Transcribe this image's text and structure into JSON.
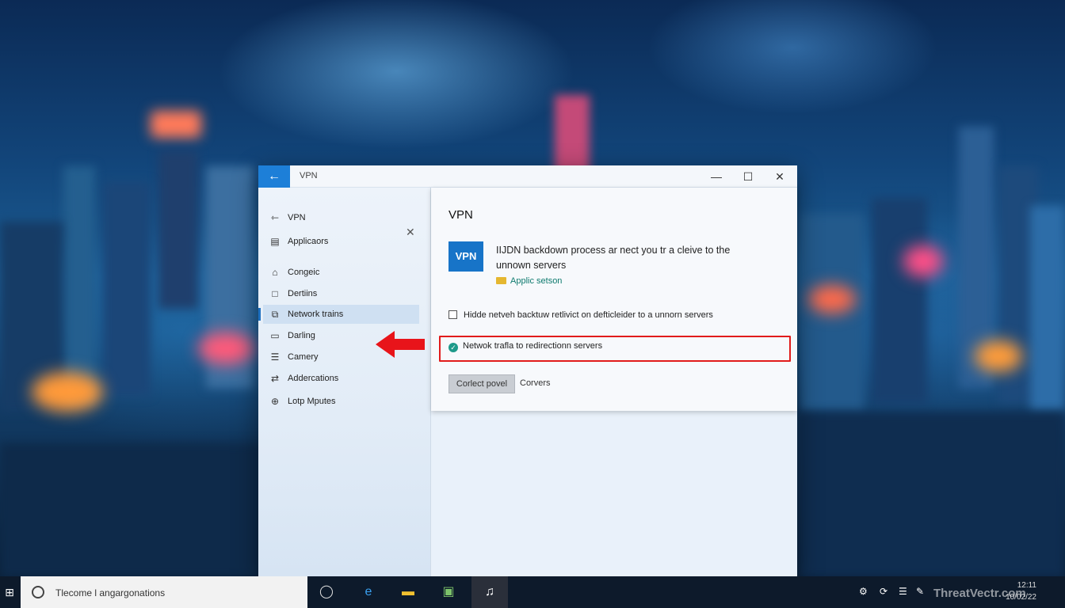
{
  "window": {
    "title": "VPN",
    "back_icon": "arrow-left-icon",
    "controls": {
      "minimize": "—",
      "maximize": "☐",
      "close": "✕"
    }
  },
  "sidebar": {
    "close_label": "✕",
    "items": [
      {
        "label": "VPN",
        "icon": "back-arrow-icon",
        "glyph": "⇽"
      },
      {
        "label": "Applicaors",
        "icon": "document-icon",
        "glyph": "▤"
      },
      {
        "label": "Congeic",
        "icon": "home-icon",
        "glyph": "⌂"
      },
      {
        "label": "Dertiins",
        "icon": "square-icon",
        "glyph": "□"
      },
      {
        "label": "Network trains",
        "icon": "network-icon",
        "glyph": "⧉"
      },
      {
        "label": "Darling",
        "icon": "folder-icon",
        "glyph": "▭"
      },
      {
        "label": "Camery",
        "icon": "list-icon",
        "glyph": "☰"
      },
      {
        "label": "Addercations",
        "icon": "shuffle-icon",
        "glyph": "⇄"
      },
      {
        "label": "Lotp Mputes",
        "icon": "globe-icon",
        "glyph": "⊕"
      }
    ],
    "active_index": 4
  },
  "panel": {
    "title": "VPN",
    "vpn_badge": "VPN",
    "description": "IIJDN backdown process ar nect you tr a cleive to the unnown servers",
    "apply_link": "Applic setson",
    "option1": "Hidde netveh backtuw retlivict on defticleider to a unnorn servers",
    "option2": "Netwok trafla to redirectionn servers",
    "primary_button": "Corlect povel",
    "secondary_button": "Corvers"
  },
  "taskbar": {
    "start_glyph": "⊞",
    "search_text": "Tlecome l angargonations",
    "apps": [
      {
        "name": "cortana-icon",
        "glyph": "◯",
        "color": "#dddddd"
      },
      {
        "name": "edge-icon",
        "glyph": "e",
        "color": "#3aa0f0"
      },
      {
        "name": "file-explorer-icon",
        "glyph": "▬",
        "color": "#f0c030"
      },
      {
        "name": "photos-icon",
        "glyph": "▣",
        "color": "#7cc26a"
      },
      {
        "name": "music-icon",
        "glyph": "♫",
        "color": "#ffffff"
      }
    ],
    "tray": [
      {
        "name": "network-tray-icon",
        "glyph": "⚙"
      },
      {
        "name": "sync-tray-icon",
        "glyph": "⟳"
      },
      {
        "name": "wifi-tray-icon",
        "glyph": "☰"
      },
      {
        "name": "pen-tray-icon",
        "glyph": "✎"
      }
    ],
    "clock_time": "12:11",
    "clock_date": "10/02/22",
    "watermark": "ThreatVectr.com"
  }
}
